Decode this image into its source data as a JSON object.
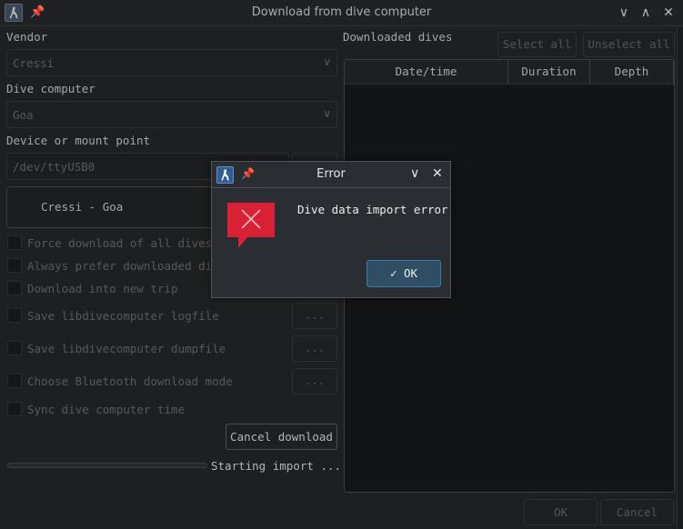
{
  "window": {
    "title": "Download from dive computer",
    "app_icon": "subsurface-diver-icon",
    "pin_icon": "pin-icon",
    "controls": [
      "minimize-icon",
      "maximize-icon",
      "close-icon"
    ]
  },
  "left_panel": {
    "vendor_label": "Vendor",
    "vendor_value": "Cressi",
    "dive_computer_label": "Dive computer",
    "dive_computer_value": "Goa",
    "device_label": "Device or mount point",
    "device_value": "/dev/ttyUSB0",
    "device_browse_label": "...",
    "selected_device": "Cressi - Goa",
    "options": [
      {
        "label": "Force download of all dives",
        "checked": false
      },
      {
        "label": "Always prefer downloaded dives",
        "checked": false
      },
      {
        "label": "Download into new trip",
        "checked": false
      },
      {
        "label": "Save libdivecomputer logfile",
        "checked": false,
        "button": "..."
      },
      {
        "label": "Save libdivecomputer dumpfile",
        "checked": false,
        "button": "..."
      },
      {
        "label": "Choose Bluetooth download mode",
        "checked": false,
        "button": "..."
      },
      {
        "label": "Sync dive computer time",
        "checked": false
      }
    ],
    "cancel_download_label": "Cancel download",
    "progress_percent": 0,
    "status_text": "Starting import ..."
  },
  "right_panel": {
    "downloaded_label": "Downloaded dives",
    "select_all_label": "Select all",
    "unselect_all_label": "Unselect all",
    "columns": [
      "Date/time",
      "Duration",
      "Depth"
    ],
    "rows": []
  },
  "footer": {
    "ok_label": "OK",
    "cancel_label": "Cancel"
  },
  "error_dialog": {
    "title": "Error",
    "message": "Dive data import error",
    "ok_label": "OK",
    "icon": "error-icon",
    "accent_color": "#da2037"
  }
}
